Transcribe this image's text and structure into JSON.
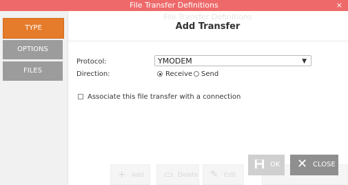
{
  "window": {
    "title": "File Transfer Definitions",
    "close_glyph": "×",
    "background_title": "File Transfer Definitions"
  },
  "sidebar": {
    "tabs": [
      {
        "label": "TYPE",
        "active": true
      },
      {
        "label": "OPTIONS",
        "active": false
      },
      {
        "label": "FILES",
        "active": false
      }
    ]
  },
  "dialog": {
    "title": "Add Transfer",
    "protocol_label": "Protocol:",
    "protocol_value": "YMODEM",
    "direction_label": "Direction:",
    "direction_options": [
      {
        "label": "Receive",
        "selected": true
      },
      {
        "label": "Send",
        "selected": false
      }
    ],
    "associate_label": "Associate this file transfer with a connection",
    "associate_checked": false
  },
  "buttons": {
    "ok_label": "OK",
    "close_label": "CLOSE"
  },
  "background_toolbar": [
    {
      "label": "Add",
      "icon": "plus-icon"
    },
    {
      "label": "Delete",
      "icon": "delete-icon"
    },
    {
      "label": "Edit",
      "icon": "edit-icon"
    }
  ],
  "colors": {
    "titlebar": "#ee6a6a",
    "active_tab": "#e57c2b",
    "inactive_tab": "#9c9c9c",
    "ok_button": "#cfcfcf",
    "close_button": "#8f8f8f"
  }
}
